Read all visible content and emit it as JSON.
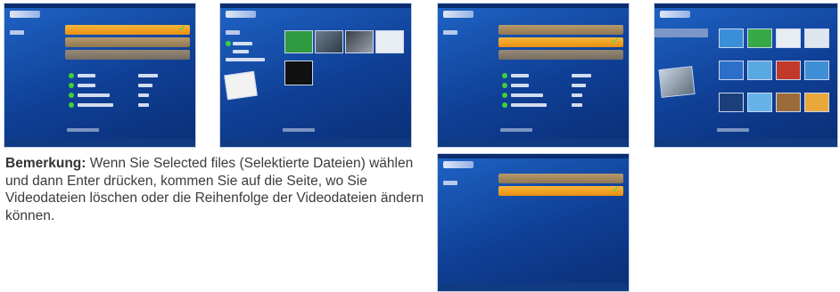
{
  "note": {
    "label": "Bemerkung:",
    "text": "Wenn Sie Selected files (Selektierte Dateien) wählen und dann Enter drücken, kommen Sie auf die Seite, wo Sie Videodateien löschen oder die Reihenfolge der Videodateien ändern können."
  },
  "icons": {
    "check": "checkmark-icon",
    "status": "green-dot-icon"
  },
  "colors": {
    "screen_bg": "#1a57b8",
    "highlight": "#f2a526",
    "check": "#59d44a"
  }
}
